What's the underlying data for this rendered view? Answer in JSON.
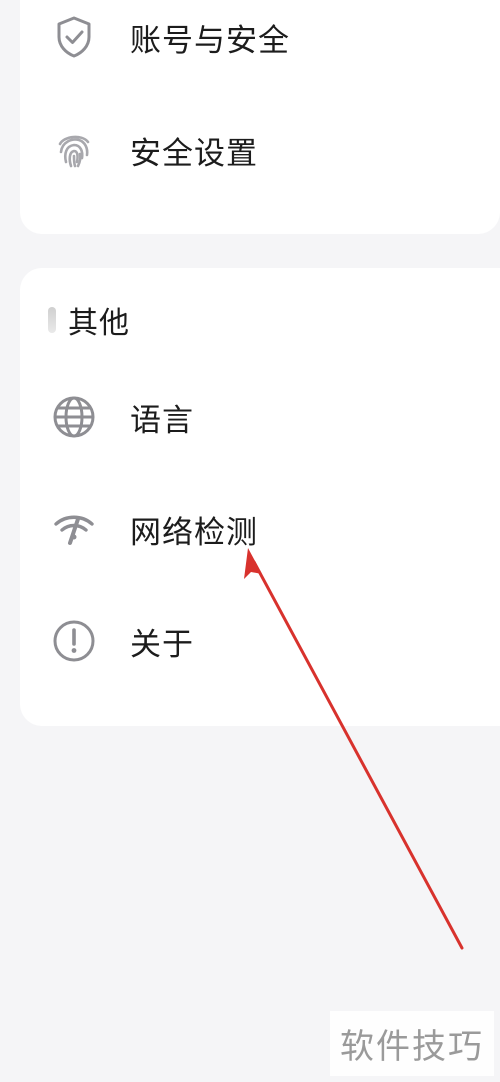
{
  "settings": {
    "account_security": {
      "label": "账号与安全",
      "icon": "shield-check-icon"
    },
    "security_settings": {
      "label": "安全设置",
      "icon": "fingerprint-icon"
    }
  },
  "other": {
    "title": "其他",
    "items": [
      {
        "label": "语言",
        "icon": "globe-icon"
      },
      {
        "label": "网络检测",
        "icon": "wifi-signal-icon"
      },
      {
        "label": "关于",
        "icon": "info-circle-icon"
      }
    ]
  },
  "annotation": {
    "color": "#d8322d",
    "target": "网络检测"
  },
  "watermark": {
    "text": "软件技巧"
  },
  "colors": {
    "background": "#f5f5f7",
    "card": "#ffffff",
    "icon": "#8e8e93",
    "text": "#1c1c1c"
  }
}
